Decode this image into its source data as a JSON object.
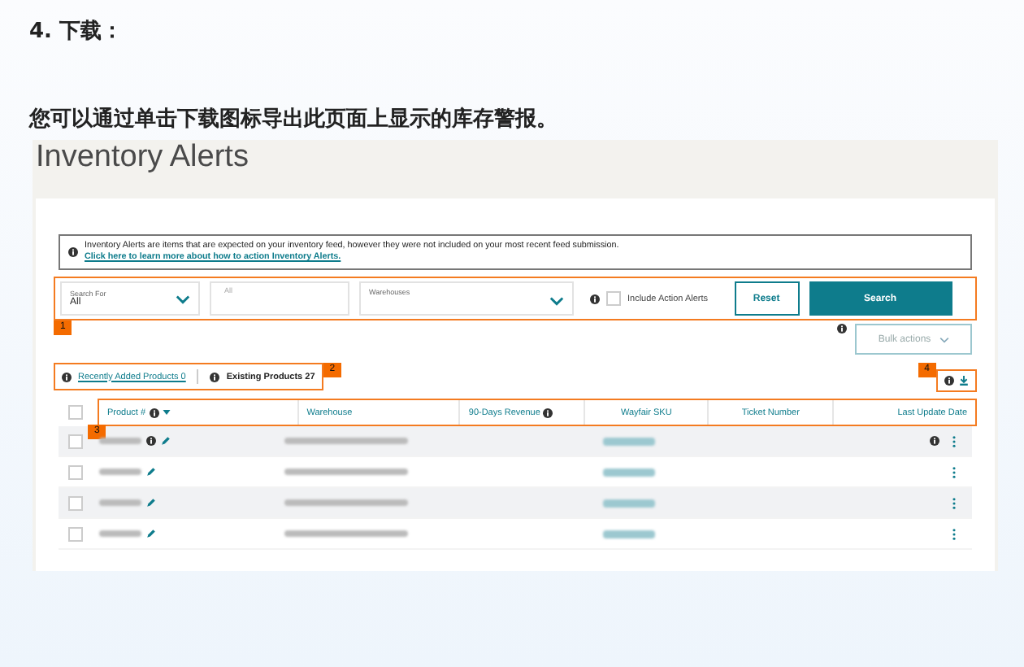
{
  "heading": "4. 下载：",
  "intro": "您可以通过单击下载图标导出此页面上显示的库存警报。",
  "screenshot": {
    "title": "Inventory Alerts",
    "notice": {
      "text": "Inventory Alerts are items that are expected on your inventory feed, however they were not included on your most recent feed submission.",
      "link": "Click here to learn more about how to action Inventory Alerts."
    },
    "filters": {
      "callout": "1",
      "search_for": {
        "label": "Search For",
        "value": "All"
      },
      "keyword": {
        "placeholder": "All"
      },
      "warehouses": {
        "label": "Warehouses"
      },
      "include_action_alerts": {
        "label": "Include Action Alerts",
        "checked": false
      },
      "reset": "Reset",
      "search": "Search"
    },
    "bulk_actions": "Bulk actions",
    "tabs_callout": "2",
    "tabs": [
      {
        "label": "Recently Added Products 0",
        "selected": false
      },
      {
        "label": "Existing Products 27",
        "selected": true
      }
    ],
    "download_callout": "4",
    "header_callout": "3",
    "select_all_checked": false,
    "columns": [
      {
        "label": "Product #",
        "info": true,
        "sortable": true
      },
      {
        "label": "Warehouse",
        "info": false,
        "sortable": false
      },
      {
        "label": "90-Days Revenue",
        "info": true,
        "sortable": false
      },
      {
        "label": "Wayfair SKU",
        "info": false,
        "sortable": false
      },
      {
        "label": "Ticket Number",
        "info": false,
        "sortable": false
      },
      {
        "label": "Last Update Date",
        "info": false,
        "sortable": false
      }
    ],
    "rows": [
      {
        "checked": false,
        "alert": true
      },
      {
        "checked": false,
        "alert": false
      },
      {
        "checked": false,
        "alert": false
      },
      {
        "checked": false,
        "alert": false
      }
    ]
  }
}
